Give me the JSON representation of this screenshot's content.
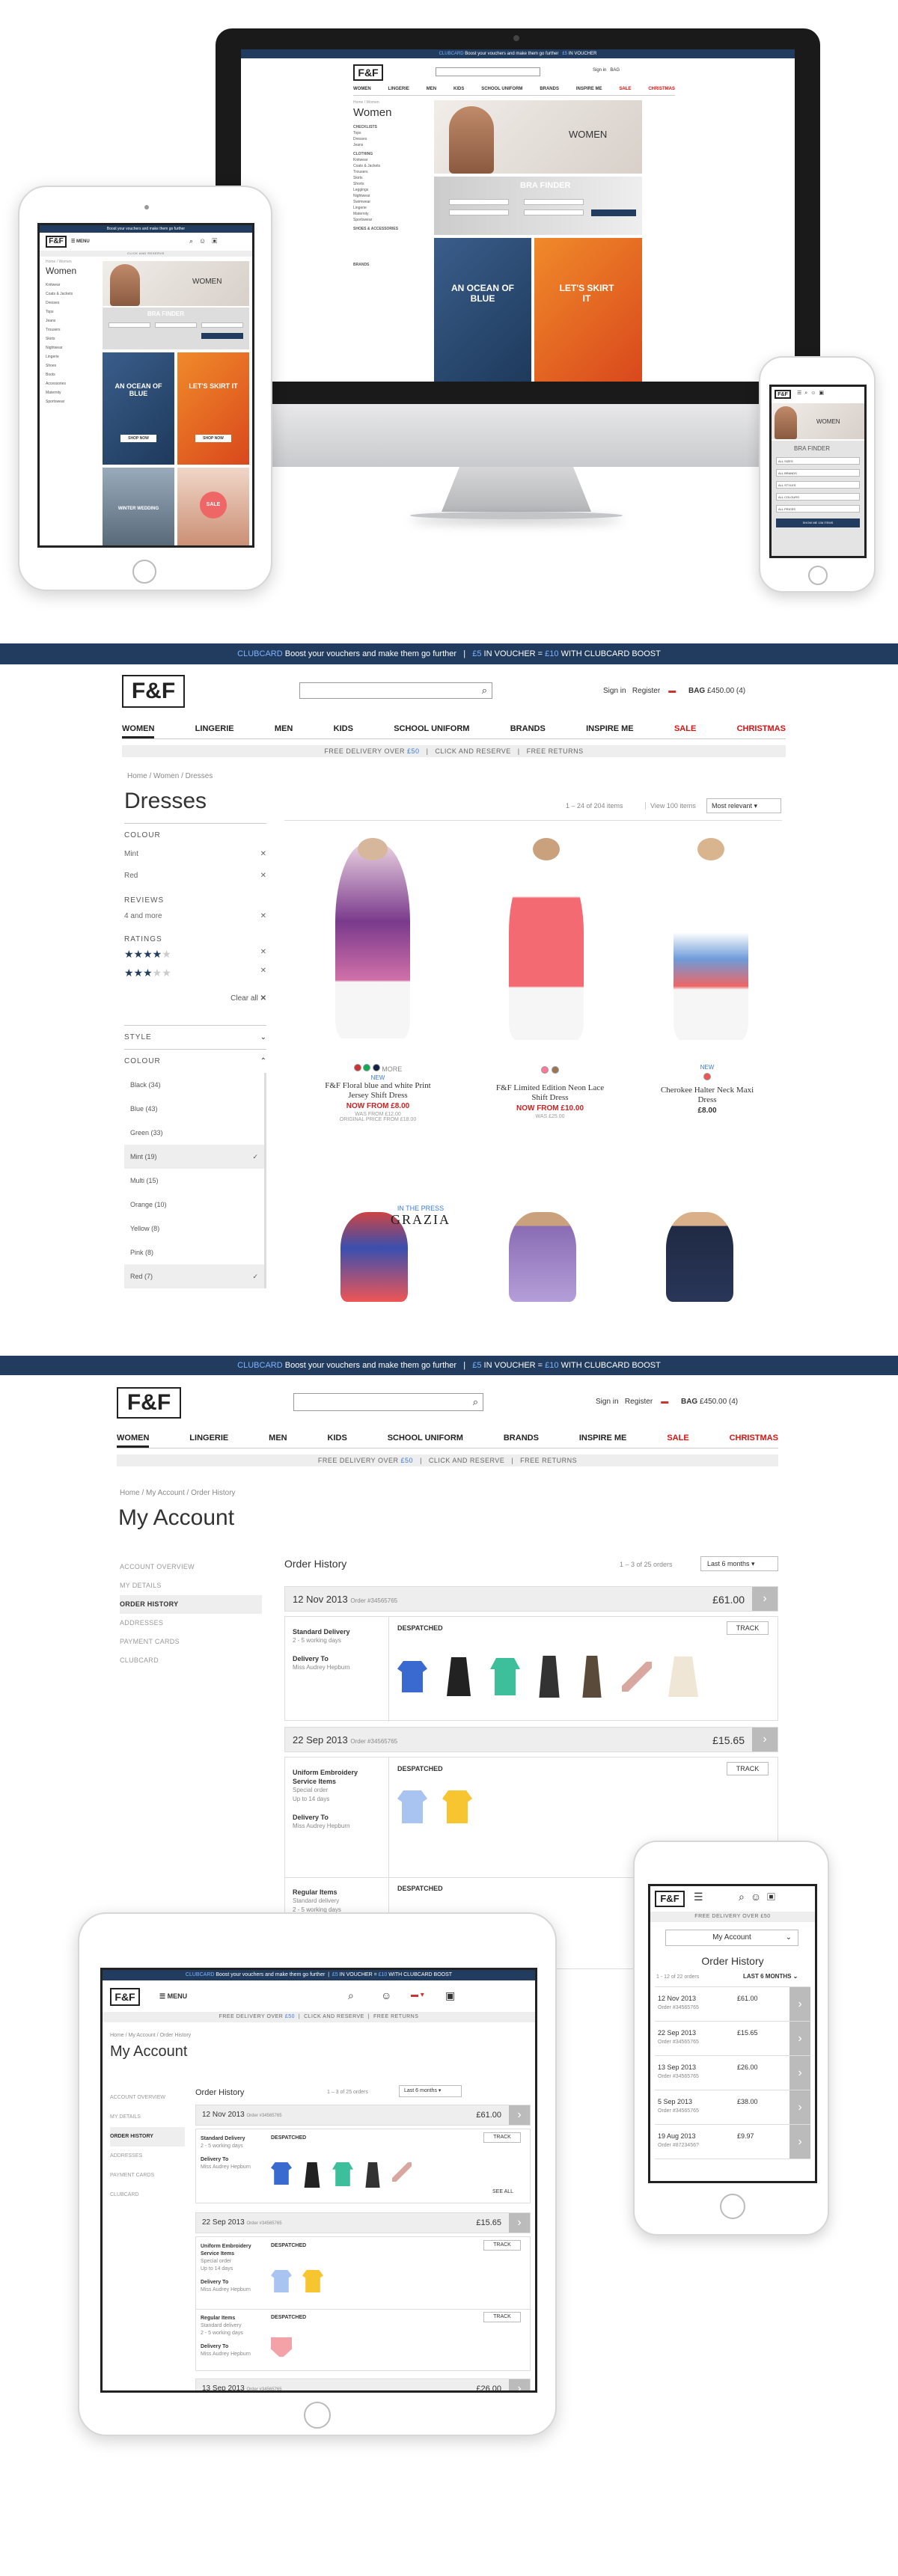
{
  "promo": {
    "clubcard": "CLUBCARD",
    "text": "Boost your vouchers and make them go further",
    "voucher5": "£5",
    "in_voucher": "IN VOUCHER",
    "eq": "=",
    "voucher10": "£10",
    "with": "WITH CLUBCARD BOOST"
  },
  "header": {
    "logo": "F&F",
    "sign_in": "Sign in",
    "register": "Register",
    "bag": "BAG",
    "bag_value": "£450.00 (4)",
    "menu": "MENU"
  },
  "nav": [
    "WOMEN",
    "LINGERIE",
    "MEN",
    "KIDS",
    "SCHOOL UNIFORM",
    "BRANDS",
    "INSPIRE ME",
    "SALE",
    "CHRISTMAS"
  ],
  "usp": {
    "delivery": "FREE DELIVERY OVER",
    "delivery_amount": "£50",
    "click": "CLICK AND RESERVE",
    "returns": "FREE RETURNS"
  },
  "imac": {
    "breadcrumb": "Home / Women",
    "title": "Women",
    "hero_title": "WOMEN",
    "bra_finder": "BRA FINDER",
    "ocean": "AN OCEAN OF BLUE",
    "skirt": "LET'S SKIRT IT",
    "sidebar_sections": [
      "CHECKLISTS",
      "CLOTHING",
      "SHOES & ACCESSORIES",
      "BRANDS"
    ],
    "sidebar_items": [
      "Tops",
      "Dresses",
      "Jeans",
      "Knitwear",
      "Coats & Jackets",
      "Trousers",
      "Skirts",
      "Shorts",
      "Leggings",
      "Nightwear",
      "Swimwear",
      "Lingerie",
      "Maternity",
      "Sportswear"
    ]
  },
  "ipad_top": {
    "breadcrumb": "Home / Women",
    "title": "Women",
    "hero_title": "WOMEN",
    "bra_finder": "BRA FINDER",
    "ocean": "AN OCEAN OF BLUE",
    "skirt": "LET'S SKIRT IT",
    "shop_now": "SHOP NOW",
    "winter": "WINTER WEDDING",
    "sale": "SALE",
    "sale_sub": "Up to 50% off",
    "side_items": [
      "Knitwear",
      "Coats & Jackets",
      "Dresses",
      "Tops",
      "Jeans",
      "Trousers",
      "Skirts",
      "Nightwear",
      "Lingerie",
      "Shoes",
      "Boots",
      "Accessories",
      "Maternity",
      "Sportswear"
    ]
  },
  "phone_top": {
    "title": "WOMEN",
    "bra_finder": "BRA FINDER",
    "selects": [
      "ALL SIZES",
      "ALL BRANDS",
      "ALL STYLES",
      "ALL COLOURS",
      "ALL PRICES"
    ],
    "button": "SHOW ME 136 ITEMS"
  },
  "plp": {
    "breadcrumb": [
      "Home",
      "Women",
      "Dresses"
    ],
    "title": "Dresses",
    "count": "1 – 24 of 204 items",
    "view": "View 100 items",
    "sort": "Most relevant",
    "colour_heading": "COLOUR",
    "selected_colours": [
      "Mint",
      "Red"
    ],
    "reviews_heading": "REVIEWS",
    "reviews_value": "4 and more",
    "ratings_heading": "RATINGS",
    "clear_all": "Clear all",
    "style_heading": "STYLE",
    "colour_heading2": "COLOUR",
    "colour_options": [
      "Black (34)",
      "Blue (43)",
      "Green (33)",
      "Mint (19)",
      "Multi (15)",
      "Orange (10)",
      "Yellow (8)",
      "Pink (8)",
      "Red (7)"
    ],
    "products": [
      {
        "badge": "NEW",
        "name": "F&F Floral blue and white Print Jersey Shift Dress",
        "price": "NOW FROM £8.00",
        "was": "WAS FROM £12.00",
        "orig": "ORIGINAL PRICE FROM £18.00",
        "more": "MORE"
      },
      {
        "badge": "",
        "name": "F&F Limited Edition Neon Lace Shift Dress",
        "price": "NOW FROM £10.00",
        "was": "WAS £25.00",
        "orig": "",
        "more": ""
      },
      {
        "badge": "NEW",
        "name": "Cherokee Halter Neck Maxi Dress",
        "price": "£8.00",
        "was": "",
        "orig": "",
        "more": ""
      }
    ],
    "press_badge": "IN THE PRESS",
    "press_title": "GRAZIA"
  },
  "account": {
    "breadcrumb": [
      "Home",
      "My Account",
      "Order History"
    ],
    "title": "My Account",
    "menu": [
      "ACCOUNT OVERVIEW",
      "MY DETAILS",
      "ORDER HISTORY",
      "ADDRESSES",
      "PAYMENT CARDS",
      "CLUBCARD"
    ],
    "section_title": "Order History",
    "count": "1 – 3 of 25 orders",
    "count_ipad": "1 – 3 of 25 orders",
    "period": "Last 6 months",
    "order_label": "Order",
    "orders": [
      {
        "date": "12 Nov 2013",
        "number": "#34565765",
        "total": "£61.00"
      },
      {
        "date": "22 Sep 2013",
        "number": "#34565765",
        "total": "£15.65"
      },
      {
        "date": "13 Sep 2013",
        "number": "#34565765",
        "total": "£26.00"
      }
    ],
    "standard_delivery": "Standard Delivery",
    "delivery_days": "2 - 5 working days",
    "delivery_to": "Delivery To",
    "recipient": "Miss Audrey Hepburn",
    "despatched": "DESPATCHED",
    "track": "TRACK",
    "embroidery": "Uniform Embroidery Service Items",
    "special_order": "Special order",
    "up_to": "Up to 14 days",
    "regular": "Regular Items",
    "standard_short": "Standard delivery",
    "see_all": "SEE ALL"
  },
  "phone_bottom": {
    "delivery": "FREE DELIVERY OVER £50",
    "account_select": "My Account",
    "title": "Order History",
    "count": "1 - 12 of 22 orders",
    "period": "LAST 6 MONTHS",
    "orders": [
      {
        "date": "12 Nov 2013",
        "number": "Order #34565765",
        "total": "£61.00"
      },
      {
        "date": "22 Sep 2013",
        "number": "Order #34565765",
        "total": "£15.65"
      },
      {
        "date": "13 Sep 2013",
        "number": "Order #34565765",
        "total": "£26.00"
      },
      {
        "date": "5 Sep 2013",
        "number": "Order #34565765",
        "total": "£38.00"
      },
      {
        "date": "19 Aug 2013",
        "number": "Order #8723456?",
        "total": "£9.97"
      }
    ]
  },
  "colors": {
    "promo_bg": "#213c5e",
    "accent_blue": "#7fb3ff",
    "sale_red": "#dd1111",
    "price_red": "#cc2222"
  }
}
